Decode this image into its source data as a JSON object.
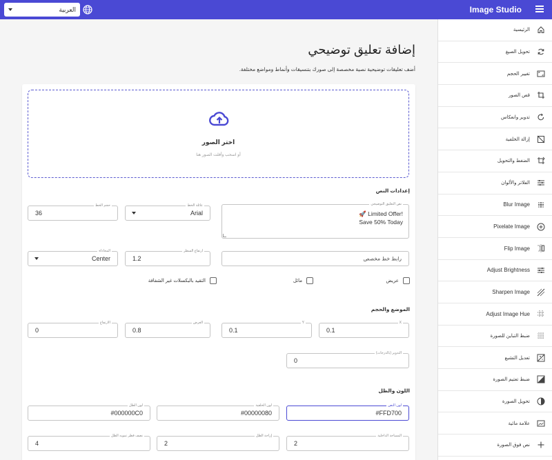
{
  "topbar": {
    "language": "العربية",
    "title": "Image Studio"
  },
  "sidebar": {
    "items": [
      {
        "label": "الرئيسية",
        "icon": "home-icon"
      },
      {
        "label": "تحويل الصيغ",
        "icon": "sync-icon"
      },
      {
        "label": "تغيير الحجم",
        "icon": "aspect-icon"
      },
      {
        "label": "قص الصور",
        "icon": "crop-icon"
      },
      {
        "label": "تدوير وانعكاس",
        "icon": "rotate-icon"
      },
      {
        "label": "إزالة الخلفية",
        "icon": "hide-image-icon"
      },
      {
        "label": "الضغط والتحويل",
        "icon": "transform-icon"
      },
      {
        "label": "الفلاتر والألوان",
        "icon": "tune-icon"
      },
      {
        "label": "Blur Image",
        "icon": "blur-icon"
      },
      {
        "label": "Pixelate Image",
        "icon": "plus-circle-icon"
      },
      {
        "label": "Flip Image",
        "icon": "flip-icon"
      },
      {
        "label": "Adjust Brightness",
        "icon": "sliders-icon"
      },
      {
        "label": "Sharpen Image",
        "icon": "sharpen-icon"
      },
      {
        "label": "Adjust Image Hue",
        "icon": "hue-grid-icon"
      },
      {
        "label": "ضبط التباين للصورة",
        "icon": "contrast-grid-icon"
      },
      {
        "label": "تعديل التشبع",
        "icon": "saturation-icon"
      },
      {
        "label": "ضبط تعتيم الصورة",
        "icon": "opacity-icon"
      },
      {
        "label": "تحويل الصورة",
        "icon": "contrast-circle-icon"
      },
      {
        "label": "علامة مائية",
        "icon": "image-frame-icon"
      },
      {
        "label": "نص فوق الصورة",
        "icon": "plus-icon"
      }
    ]
  },
  "main": {
    "title": "إضافة تعليق توضيحي",
    "description": "أضف تعليقات توضيحية نصية مخصصة إلى صورك بتنسيقات وأنماط ومواضع مختلفة."
  },
  "dropzone": {
    "title": "اختر الصور",
    "subtitle": "أو اسحب وأفلت الصور هنا"
  },
  "text_settings": {
    "section_title": "إعدادات النص",
    "caption_label": "نص التعليق التوضيحي",
    "caption_line1": "🚀 Limited Offer!",
    "caption_line2": "Save 50% Today",
    "font_label": "عائلة الخط",
    "font_value": "Arial",
    "size_label": "حجم الخط",
    "size_value": "36",
    "custom_font_placeholder": "رابط خط مخصص",
    "line_height_label": "ارتفاع السطر",
    "line_height_value": "1.2",
    "align_label": "المحاذاة",
    "align_value": "Center",
    "bold_label": "عريض",
    "italic_label": "مائل",
    "transparent_label": "التقيد بالبكسلات غير الشفافة"
  },
  "position_settings": {
    "section_title": "الموضع والحجم",
    "x_label": "X",
    "x_value": "0.1",
    "y_label": "Y",
    "y_value": "0.1",
    "width_label": "العرض",
    "width_value": "0.8",
    "height_label": "الارتفاع",
    "height_value": "0",
    "rotation_label": "التدوير (بالدرجات)",
    "rotation_value": "0"
  },
  "color_settings": {
    "section_title": "اللون والظل",
    "text_color_label": "لون النص",
    "text_color_value": "#FFD700",
    "bg_color_label": "لون الخلفية",
    "bg_color_value": "#00000080",
    "shadow_color_label": "لون الظل",
    "shadow_color_value": "#000000C0",
    "padding_label": "المساحة الداخلية",
    "padding_value": "2",
    "shadow_offset_label": "إزاحة الظل",
    "shadow_offset_value": "2",
    "shadow_blur_label": "نصف قطر تمويه الظل",
    "shadow_blur_value": "4"
  },
  "colors": {
    "accent": "#4a49d4"
  }
}
